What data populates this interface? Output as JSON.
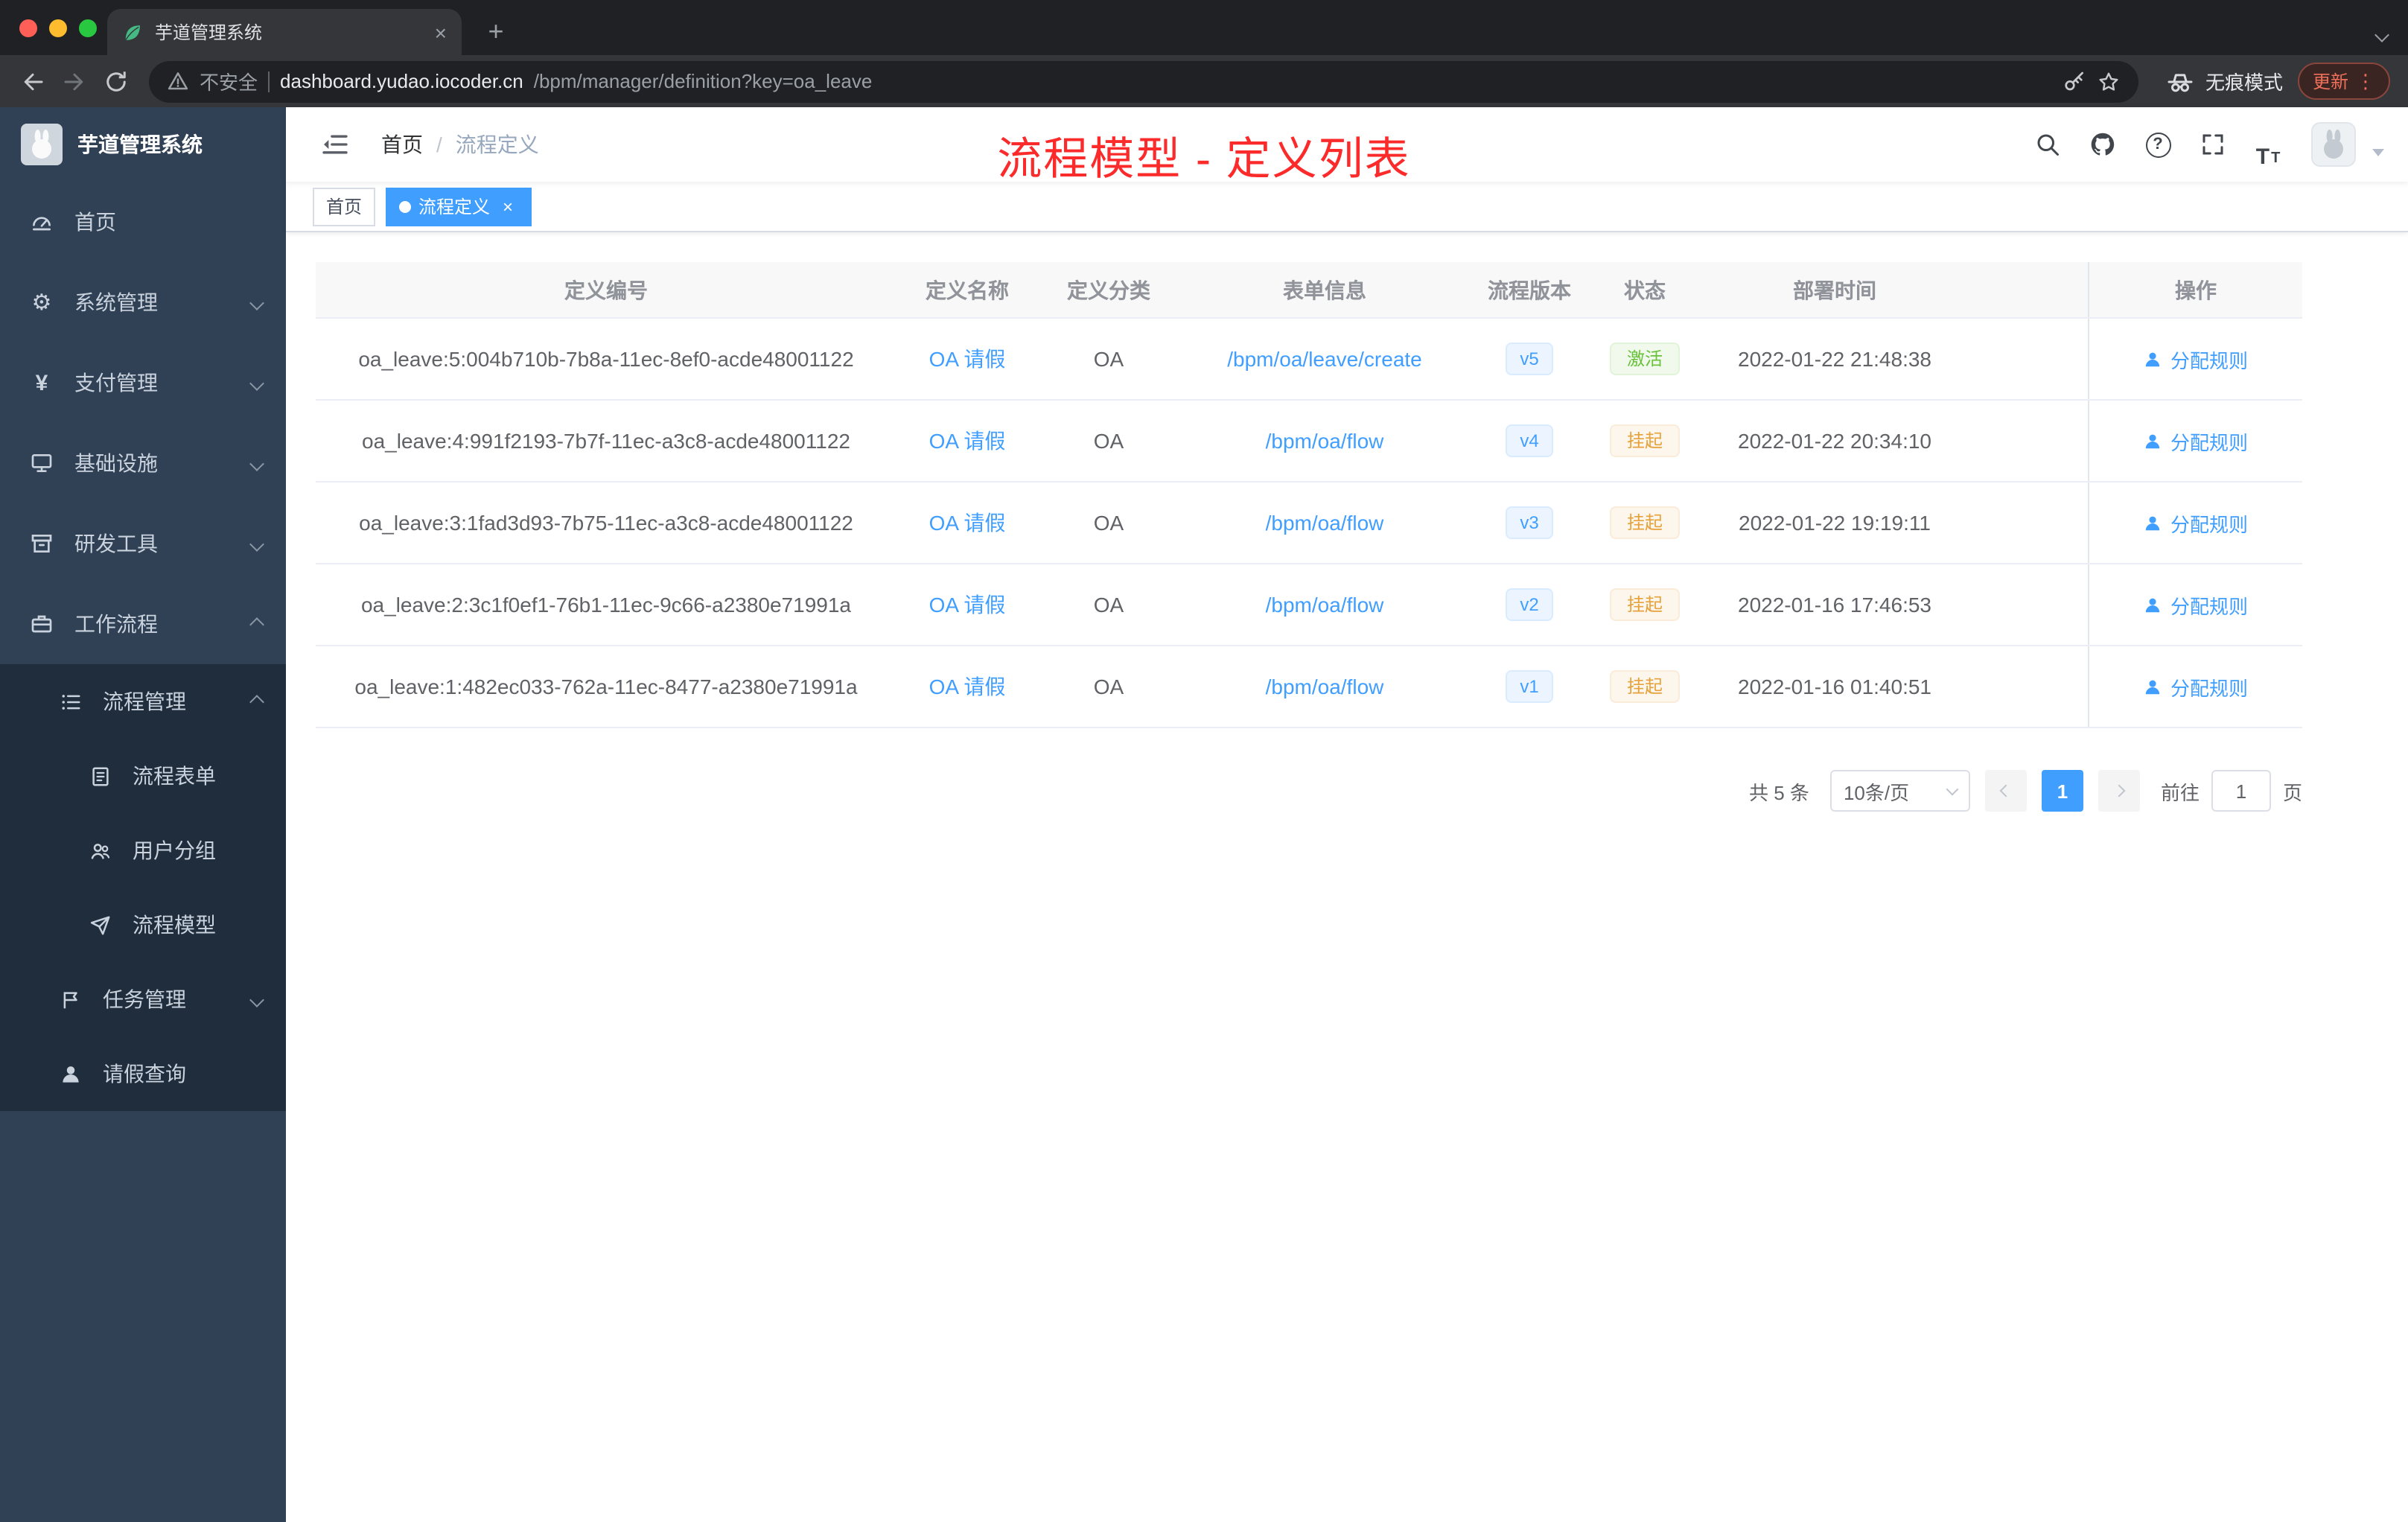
{
  "icons": {
    "close": "×",
    "new_tab": "+",
    "menu_dots": "⋮",
    "gear": "⚙",
    "yen": "¥",
    "help": "?",
    "font_size": "T"
  },
  "browser": {
    "tab": {
      "title": "芋道管理系统"
    },
    "address": {
      "security_label": "不安全",
      "host": "dashboard.yudao.iocoder.cn",
      "path": "/bpm/manager/definition?key=oa_leave"
    },
    "incognito_label": "无痕模式",
    "update_label": "更新"
  },
  "sidebar": {
    "logo_title": "芋道管理系统",
    "items": [
      {
        "label": "首页"
      },
      {
        "label": "系统管理"
      },
      {
        "label": "支付管理"
      },
      {
        "label": "基础设施"
      },
      {
        "label": "研发工具"
      },
      {
        "label": "工作流程"
      }
    ],
    "process_mgmt": {
      "label": "流程管理",
      "children": [
        {
          "label": "流程表单"
        },
        {
          "label": "用户分组"
        },
        {
          "label": "流程模型"
        }
      ]
    },
    "task_mgmt": {
      "label": "任务管理"
    },
    "leave_query": {
      "label": "请假查询"
    }
  },
  "header": {
    "breadcrumb": {
      "home": "首页",
      "separator": "/",
      "current": "流程定义"
    },
    "annotation": "流程模型 - 定义列表"
  },
  "tags": {
    "home": "首页",
    "active": "流程定义"
  },
  "table": {
    "columns": [
      "定义编号",
      "定义名称",
      "定义分类",
      "表单信息",
      "流程版本",
      "状态",
      "部署时间",
      "操作"
    ],
    "action_label": "分配规则",
    "rows": [
      {
        "id": "oa_leave:5:004b710b-7b8a-11ec-8ef0-acde48001122",
        "name": "OA 请假",
        "category": "OA",
        "form": "/bpm/oa/leave/create",
        "version": "v5",
        "status": "激活",
        "status_type": "success",
        "time": "2022-01-22 21:48:38"
      },
      {
        "id": "oa_leave:4:991f2193-7b7f-11ec-a3c8-acde48001122",
        "name": "OA 请假",
        "category": "OA",
        "form": "/bpm/oa/flow",
        "version": "v4",
        "status": "挂起",
        "status_type": "warning",
        "time": "2022-01-22 20:34:10"
      },
      {
        "id": "oa_leave:3:1fad3d93-7b75-11ec-a3c8-acde48001122",
        "name": "OA 请假",
        "category": "OA",
        "form": "/bpm/oa/flow",
        "version": "v3",
        "status": "挂起",
        "status_type": "warning",
        "time": "2022-01-22 19:19:11"
      },
      {
        "id": "oa_leave:2:3c1f0ef1-76b1-11ec-9c66-a2380e71991a",
        "name": "OA 请假",
        "category": "OA",
        "form": "/bpm/oa/flow",
        "version": "v2",
        "status": "挂起",
        "status_type": "warning",
        "time": "2022-01-16 17:46:53"
      },
      {
        "id": "oa_leave:1:482ec033-762a-11ec-8477-a2380e71991a",
        "name": "OA 请假",
        "category": "OA",
        "form": "/bpm/oa/flow",
        "version": "v1",
        "status": "挂起",
        "status_type": "warning",
        "time": "2022-01-16 01:40:51"
      }
    ]
  },
  "pagination": {
    "total": "共 5 条",
    "page_size": "10条/页",
    "current_page": "1",
    "goto_label": "前往",
    "goto_value": "1",
    "goto_unit": "页"
  },
  "colors": {
    "accent": "#409eff",
    "success": "#67c23a",
    "warning": "#e6a23c",
    "annotation_red": "#fb2b2b",
    "sidebar_bg": "#304156",
    "submenu_bg": "#1f2d3d"
  }
}
